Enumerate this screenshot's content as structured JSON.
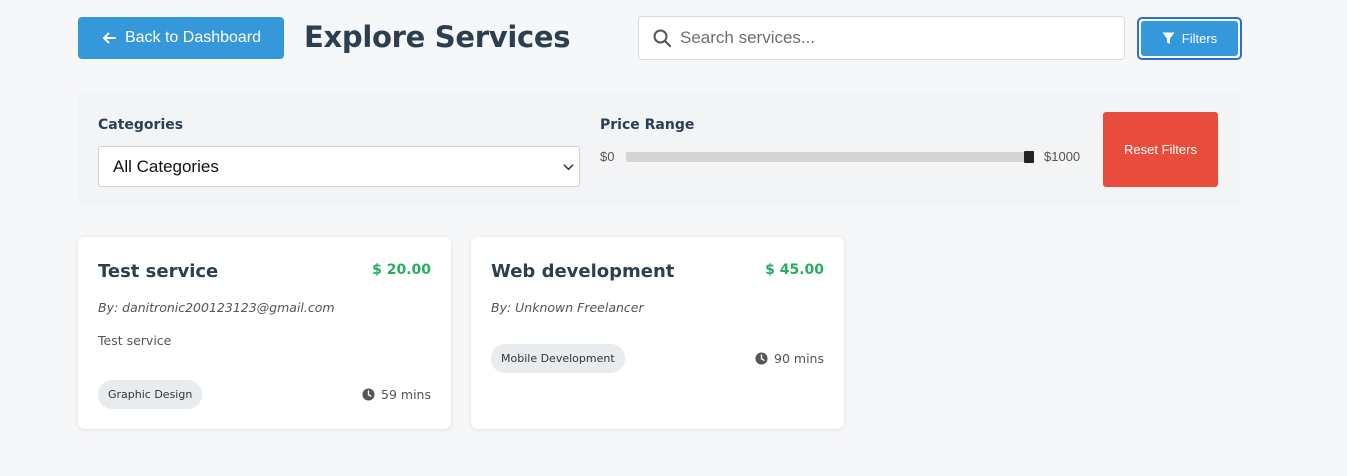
{
  "header": {
    "back_label": "Back to Dashboard",
    "title": "Explore Services",
    "search_placeholder": "Search services...",
    "search_value": "",
    "filters_label": "Filters"
  },
  "filters": {
    "categories_label": "Categories",
    "category_selected": "All Categories",
    "price_label": "Price Range",
    "price_min_label": "$0",
    "price_max_label": "$1000",
    "price_value": 1000,
    "price_max": 1000,
    "reset_label": "Reset Filters"
  },
  "services": [
    {
      "title": "Test service",
      "price": "$ 20.00",
      "author": "By: danitronic200123123@gmail.com",
      "description": "Test service",
      "category": "Graphic Design",
      "duration": "59 mins"
    },
    {
      "title": "Web development",
      "price": "$ 45.00",
      "author": "By: Unknown Freelancer",
      "description": "",
      "category": "Mobile Development",
      "duration": "90 mins"
    }
  ],
  "colors": {
    "primary": "#3498db",
    "danger": "#e74c3c",
    "price_green": "#27ae60",
    "title": "#2c3e50",
    "background": "#f6f7f9"
  },
  "icons": {
    "back": "arrow-left-icon",
    "search": "search-icon",
    "filter": "filter-icon",
    "select": "chevron-down-icon",
    "duration": "clock-icon"
  }
}
